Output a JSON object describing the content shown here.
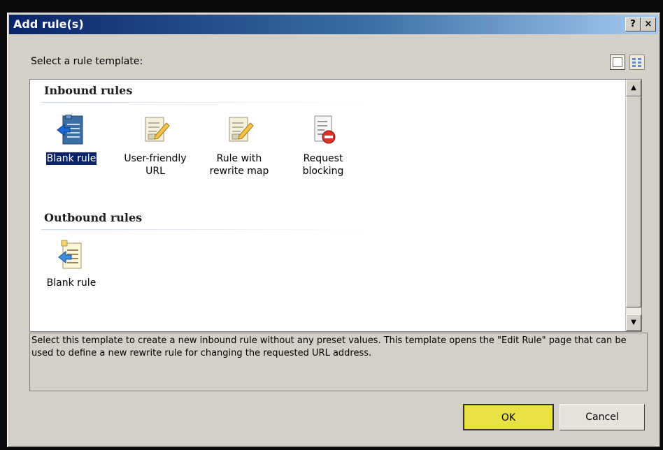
{
  "dialog": {
    "title": "Add rule(s)",
    "help_button": "?",
    "close_button": "×"
  },
  "prompt": "Select a rule template:",
  "view_buttons": [
    "large-icons-view-icon",
    "details-view-icon"
  ],
  "groups": {
    "inbound": {
      "header": "Inbound rules",
      "items": [
        {
          "label": "Blank rule",
          "icon": "blank-inbound-rule-icon",
          "selected": true
        },
        {
          "label": "User-friendly URL",
          "icon": "document-pencil-icon"
        },
        {
          "label": "Rule with rewrite map",
          "icon": "document-pencil-icon"
        },
        {
          "label": "Request blocking",
          "icon": "document-block-icon"
        }
      ]
    },
    "outbound": {
      "header": "Outbound rules",
      "items": [
        {
          "label": "Blank rule",
          "icon": "blank-outbound-rule-icon"
        }
      ]
    }
  },
  "description": "Select this template to create a new inbound rule without any preset values. This template opens the \"Edit Rule\" page that can be used to define a new rewrite rule for changing the requested URL address.",
  "buttons": {
    "ok": "OK",
    "cancel": "Cancel"
  },
  "colors": {
    "title_bar_start": "#0a246a",
    "selection": "#0a246a",
    "ok_highlight": "#e8e247"
  }
}
